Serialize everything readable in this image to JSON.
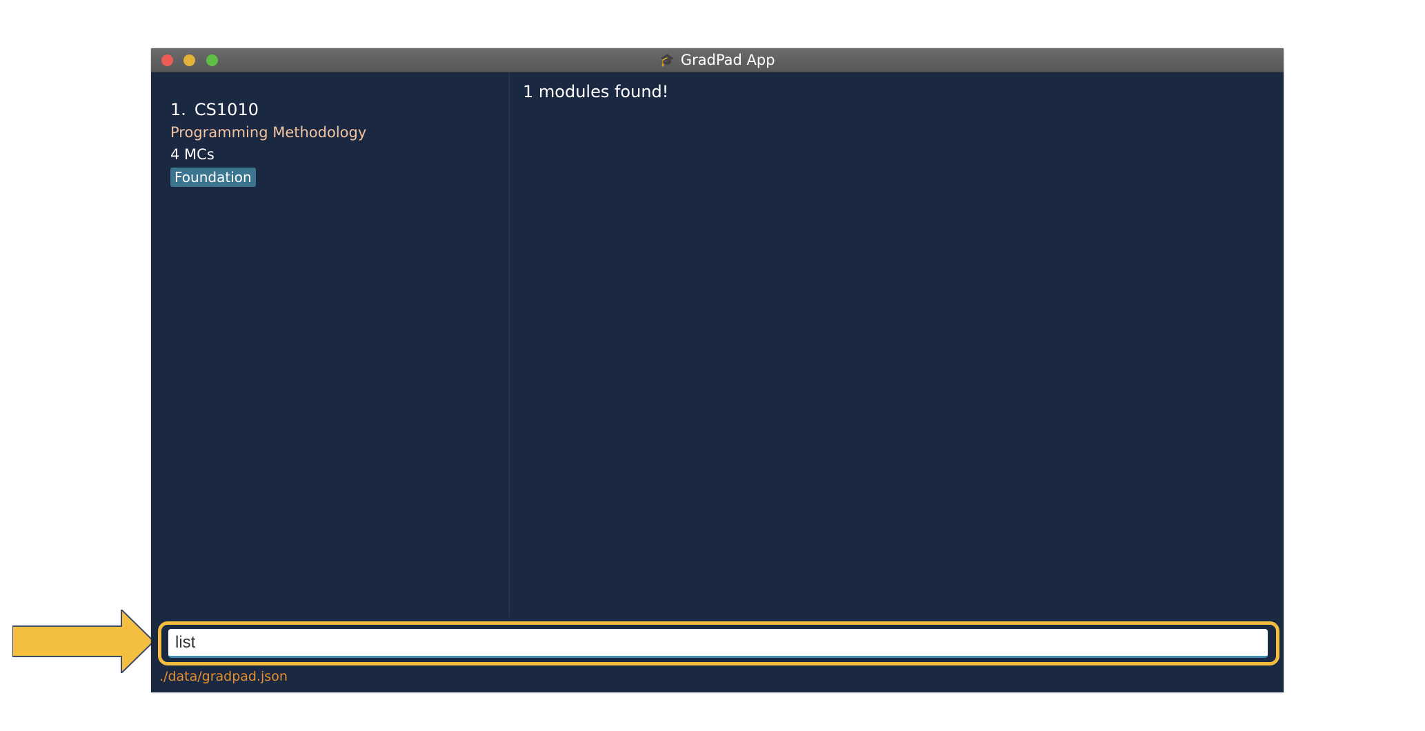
{
  "window": {
    "title": "GradPad App",
    "app_icon": "graduation-cap-icon"
  },
  "module_list": [
    {
      "index": "1.",
      "code": "CS1010",
      "name": "Programming Methodology",
      "credits": "4 MCs",
      "tag": "Foundation"
    }
  ],
  "result_display": {
    "text": "1 modules found!"
  },
  "command_box": {
    "value": "list"
  },
  "status_bar": {
    "path": "./data/gradpad.json"
  },
  "colors": {
    "background": "#1b2842",
    "accent_highlight": "#f2bc3f",
    "module_name": "#f2c4a2",
    "tag": "#3c7590",
    "status_text": "#e7902f"
  }
}
